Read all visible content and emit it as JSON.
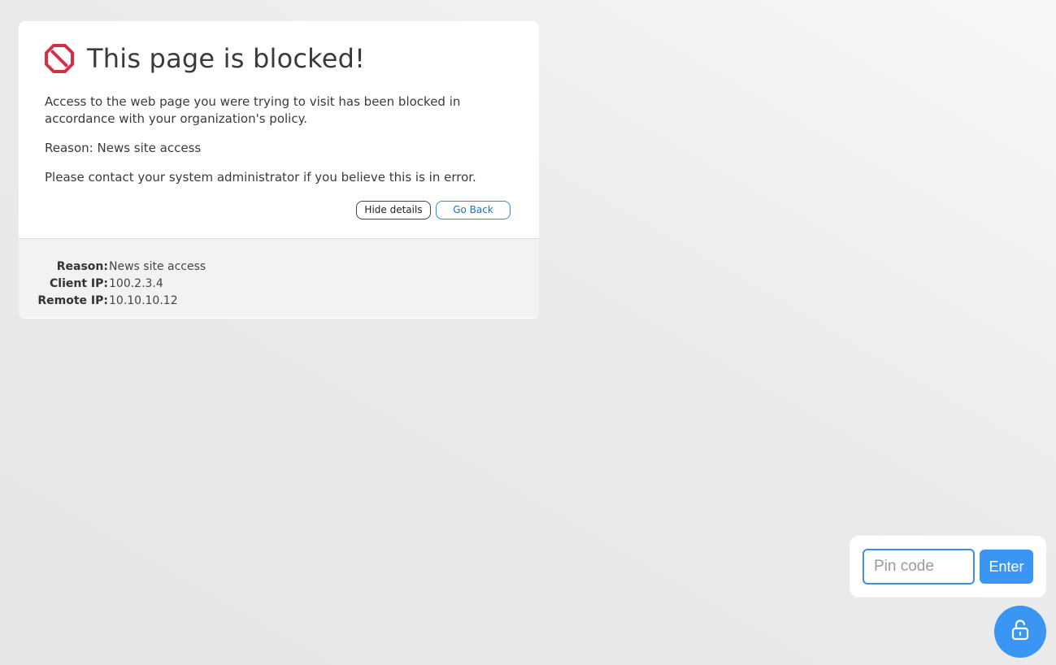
{
  "notice": {
    "title": "This page is blocked!",
    "message": "Access to the web page you were trying to visit has been blocked in accordance with your organization's policy.",
    "reason_line": "Reason: News site access",
    "contact_line": "Please contact your system administrator if you believe this is in error.",
    "hide_details_label": "Hide details",
    "go_back_label": "Go Back",
    "icon": "blocked-icon",
    "accent_color": "#d42f4a"
  },
  "details": {
    "rows": [
      {
        "label": "Reason:",
        "value": "News site access"
      },
      {
        "label": "Client IP:",
        "value": "100.2.3.4"
      },
      {
        "label": "Remote IP:",
        "value": "10.10.10.12"
      }
    ]
  },
  "pin": {
    "placeholder": "Pin code",
    "value": "",
    "enter_label": "Enter",
    "unlock_icon": "unlock-icon",
    "button_color": "#3b95f2"
  }
}
